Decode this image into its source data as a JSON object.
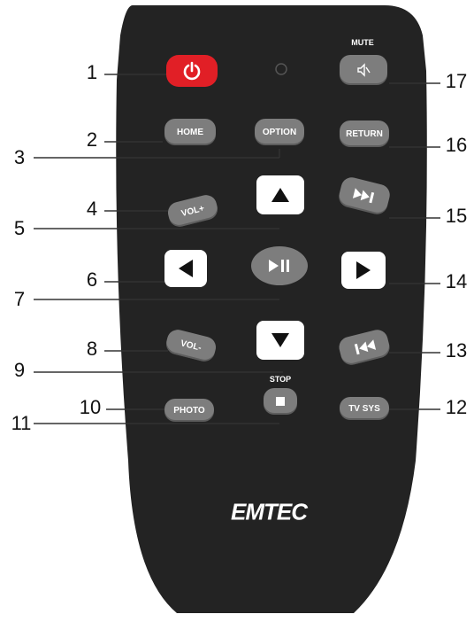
{
  "remote": {
    "brand": "EMTEC",
    "colors": {
      "body": "#232323",
      "power": "#e11f26",
      "button": "#7d7d7d",
      "nav": "#ffffff"
    }
  },
  "buttons": {
    "mute_caption": "MUTE",
    "home": "HOME",
    "option": "OPTION",
    "return": "RETURN",
    "vol_up": "VOL+",
    "vol_down": "VOL-",
    "stop_caption": "STOP",
    "photo": "PHOTO",
    "tv_sys": "TV SYS"
  },
  "icons": {
    "power": "power-icon",
    "mute": "mute-icon",
    "up": "arrow-up-icon",
    "down": "arrow-down-icon",
    "left": "arrow-left-icon",
    "right": "arrow-right-icon",
    "play_pause": "play-pause-icon",
    "next": "next-track-icon",
    "prev": "previous-track-icon",
    "stop": "stop-icon",
    "ir": "ir-sensor-icon"
  },
  "callouts": {
    "n1": "1",
    "n2": "2",
    "n3": "3",
    "n4": "4",
    "n5": "5",
    "n6": "6",
    "n7": "7",
    "n8": "8",
    "n9": "9",
    "n10": "10",
    "n11": "11",
    "n12": "12",
    "n13": "13",
    "n14": "14",
    "n15": "15",
    "n16": "16",
    "n17": "17"
  }
}
